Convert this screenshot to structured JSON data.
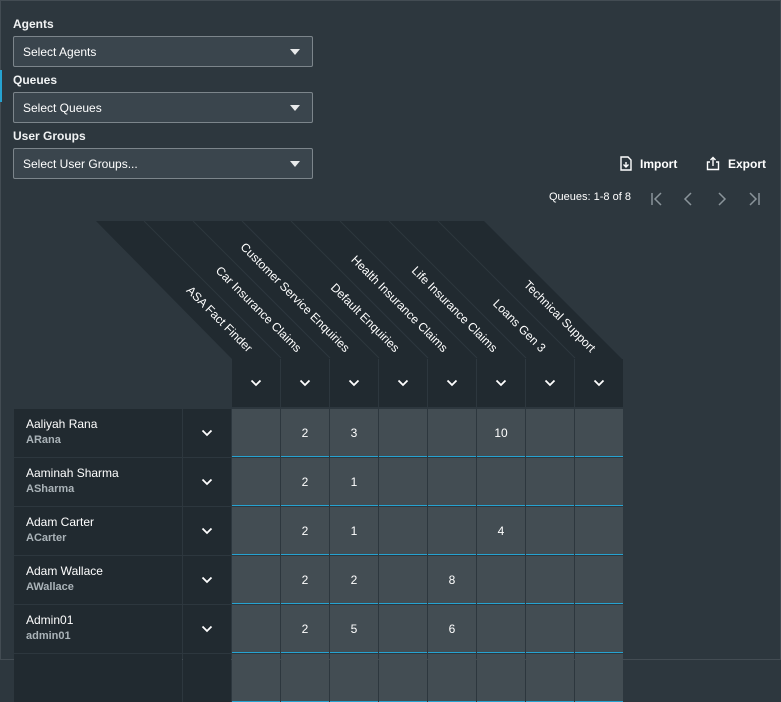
{
  "filters": {
    "agents": {
      "label": "Agents",
      "value": "Select Agents"
    },
    "queues": {
      "label": "Queues",
      "value": "Select Queues"
    },
    "user_groups": {
      "label": "User Groups",
      "value": "Select User Groups..."
    }
  },
  "toolbar": {
    "import_label": "Import",
    "export_label": "Export"
  },
  "pager": {
    "text": "Queues: 1-8 of 8"
  },
  "queues": [
    "ASA Fact Finder",
    "Car Insurance Claims",
    "Customer Service Enquiries",
    "Default Enquiries",
    "Health Insurance Claims",
    "Life Insurance Claims",
    "Loans Gen 3",
    "Technical Support"
  ],
  "agents": [
    {
      "name": "Aaliyah Rana",
      "username": "ARana",
      "values": [
        "",
        "2",
        "3",
        "",
        "",
        "10",
        "",
        ""
      ]
    },
    {
      "name": "Aaminah Sharma",
      "username": "ASharma",
      "values": [
        "",
        "2",
        "1",
        "",
        "",
        "",
        "",
        ""
      ]
    },
    {
      "name": "Adam Carter",
      "username": "ACarter",
      "values": [
        "",
        "2",
        "1",
        "",
        "",
        "4",
        "",
        ""
      ]
    },
    {
      "name": "Adam Wallace",
      "username": "AWallace",
      "values": [
        "",
        "2",
        "2",
        "",
        "8",
        "",
        "",
        ""
      ]
    },
    {
      "name": "Admin01",
      "username": "admin01",
      "values": [
        "",
        "2",
        "5",
        "",
        "6",
        "",
        "",
        ""
      ]
    }
  ],
  "colors": {
    "accent": "#26a3d1",
    "background": "#2d373e",
    "header_dark": "#212a30",
    "cell": "#434d53"
  }
}
